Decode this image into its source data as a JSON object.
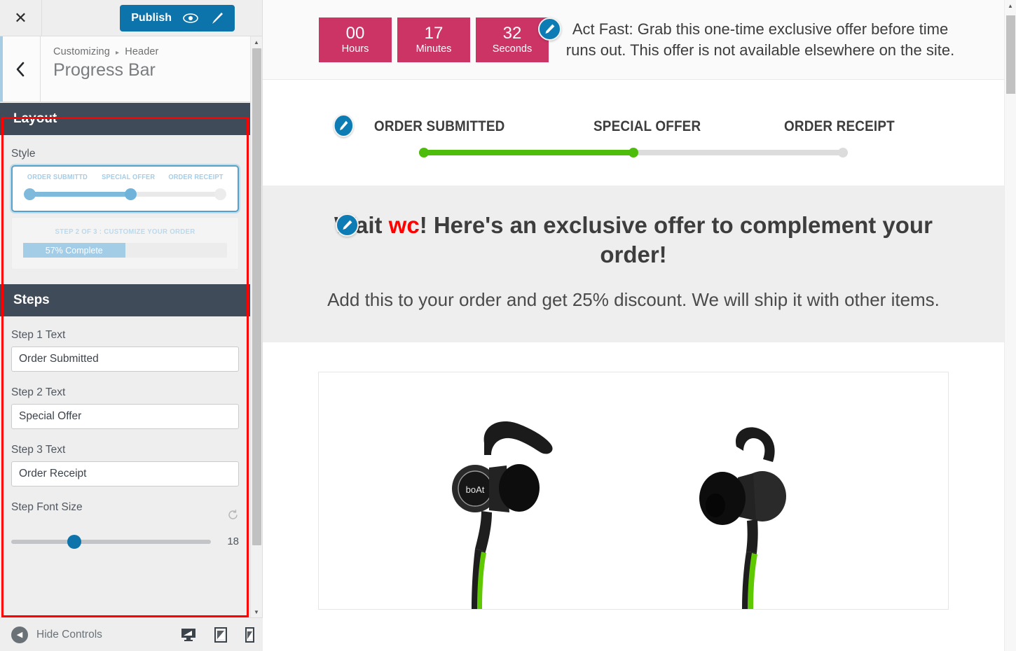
{
  "customizer": {
    "close_label": "✕",
    "publish": {
      "label": "Publish",
      "preview_icon": "eye-icon",
      "style_icon": "brush-icon"
    },
    "back_icon": "chevron-left-icon",
    "breadcrumb": {
      "root": "Customizing",
      "separator": "▸",
      "parent": "Header"
    },
    "panel_title": "Progress Bar",
    "sections": {
      "layout": {
        "title": "Layout",
        "style_label": "Style",
        "style_option_1": {
          "steps": [
            "ORDER SUBMITTD",
            "SPECIAL OFFER",
            "ORDER RECEIPT"
          ],
          "selected": true
        },
        "style_option_2": {
          "caption": "STEP 2 OF 3 : CUSTOMIZE YOUR ORDER",
          "fill_text": "57% Complete",
          "selected": false
        }
      },
      "steps": {
        "title": "Steps",
        "fields": [
          {
            "label": "Step 1 Text",
            "value": "Order Submitted"
          },
          {
            "label": "Step 2 Text",
            "value": "Special Offer"
          },
          {
            "label": "Step 3 Text",
            "value": "Order Receipt"
          }
        ],
        "font_size": {
          "label": "Step Font Size",
          "value": "18",
          "reset_icon": "reset-icon"
        }
      }
    },
    "bottom": {
      "hide_controls": "Hide Controls",
      "devices": [
        "desktop-icon",
        "tablet-icon",
        "mobile-icon"
      ]
    }
  },
  "preview": {
    "countdown": {
      "units": [
        {
          "value": "00",
          "label": "Hours"
        },
        {
          "value": "17",
          "label": "Minutes"
        },
        {
          "value": "32",
          "label": "Seconds"
        }
      ],
      "message": "Act Fast: Grab this one-time exclusive offer before time runs out. This offer is not available elsewhere on the site."
    },
    "progress": {
      "steps": [
        "ORDER SUBMITTED",
        "SPECIAL OFFER",
        "ORDER RECEIPT"
      ],
      "fill_color": "#4ebc0a",
      "track_color": "#dcdcdc",
      "percent": "50"
    },
    "headline": {
      "before": "Wait ",
      "highlight": "wc",
      "after": "! Here's an exclusive offer to complement your order!",
      "highlight_color": "#ff0000"
    },
    "subtext": "Add this to your order and get 25% discount. We will ship it with other items.",
    "product": {
      "brand": "boAt",
      "alt": "black wireless earphones with green cable"
    }
  },
  "colors": {
    "accent_blue": "#0c74ab",
    "section_header": "#3f4b58",
    "countdown_pink": "#cc3466",
    "highlight_outline": "#ff0000"
  }
}
